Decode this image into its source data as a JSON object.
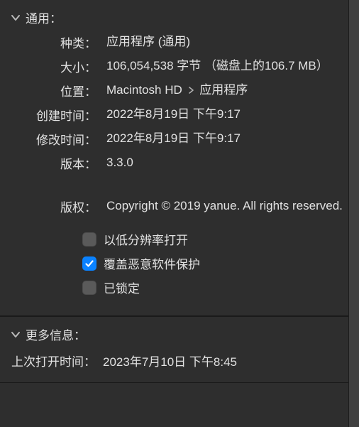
{
  "sections": {
    "general": {
      "title": "通用：",
      "fields": {
        "kind_label": "种类：",
        "kind_value": "应用程序 (通用)",
        "size_label": "大小：",
        "size_value": "106,054,538 字节  （磁盘上的106.7 MB）",
        "where_label": "位置：",
        "where_vol": "Macintosh HD",
        "where_folder": "应用程序",
        "created_label": "创建时间：",
        "created_value": "2022年8月19日 下午9:17",
        "modified_label": "修改时间：",
        "modified_value": "2022年8月19日 下午9:17",
        "version_label": "版本：",
        "version_value": "3.3.0",
        "copyright_label": "版权：",
        "copyright_value": "Copyright © 2019 yanue. All rights reserved."
      },
      "checks": {
        "low_res_label": "以低分辨率打开",
        "low_res_checked": false,
        "override_label": "覆盖恶意软件保护",
        "override_checked": true,
        "locked_label": "已锁定",
        "locked_checked": false
      }
    },
    "more": {
      "title": "更多信息：",
      "last_opened_label": "上次打开时间：",
      "last_opened_value": "2023年7月10日 下午8:45"
    }
  }
}
